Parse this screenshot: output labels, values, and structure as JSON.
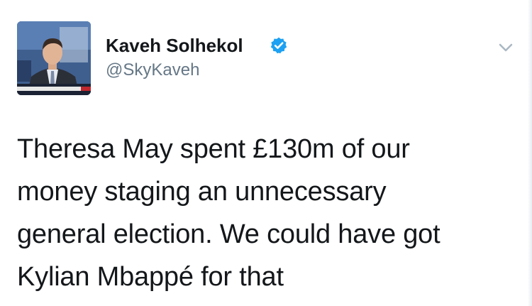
{
  "author": {
    "display_name": "Kaveh Solhekol",
    "handle": "@SkyKaveh",
    "verified": true,
    "avatar_icon": "profile-photo"
  },
  "tweet": {
    "lines": [
      "Theresa May spent £130m of our",
      "money staging an unnecessary",
      "general election. We could have got",
      "Kylian Mbappé for that"
    ]
  },
  "colors": {
    "text": "#14171a",
    "secondary": "#657786",
    "verified_blue": "#1da1f2"
  },
  "icons": {
    "verified": "verified-badge-icon",
    "menu": "chevron-down-icon"
  }
}
